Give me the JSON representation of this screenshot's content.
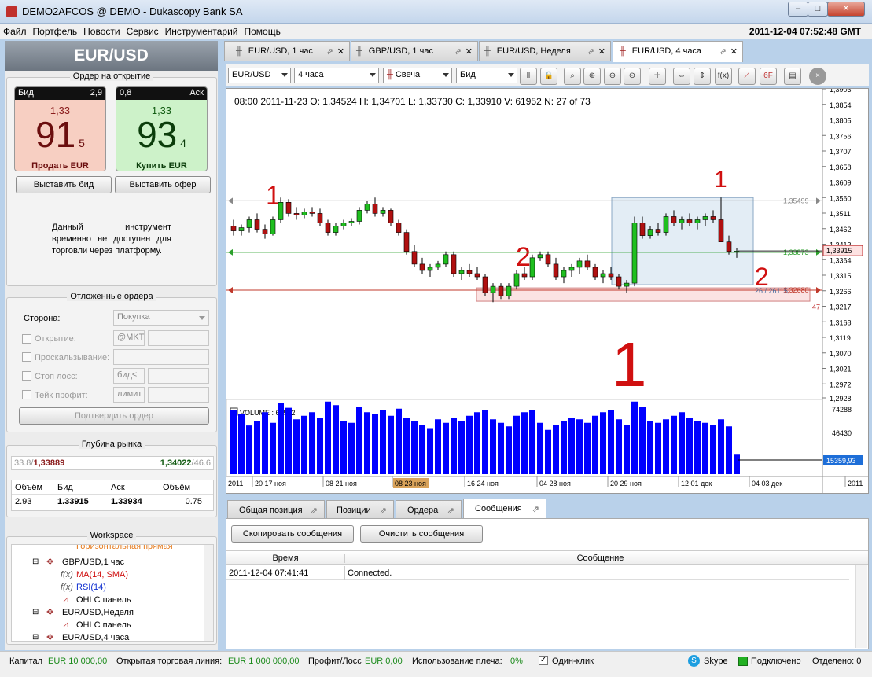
{
  "window": {
    "title": "DEMO2AFCOS @ DEMO - Dukascopy Bank SA",
    "controls": [
      "–",
      "□",
      "✕"
    ]
  },
  "menu": [
    "Файл",
    "Портфель",
    "Новости",
    "Сервис",
    "Инструментарий",
    "Помощь"
  ],
  "clock": "2011-12-04 07:52:48 GMT",
  "instrument": "EUR/USD",
  "order_panel": {
    "title": "Ордер на открытие",
    "bid": {
      "head": "Бид",
      "size": "2,9",
      "prefix": "1,33",
      "pips": "91",
      "fraction": "5",
      "action": "Продать EUR"
    },
    "ask": {
      "head": "Аск",
      "size": "0,8",
      "prefix": "1,33",
      "pips": "93",
      "fraction": "4",
      "action": "Купить EUR"
    },
    "place_bid": "Выставить бид",
    "place_offer": "Выставить офер",
    "notice": "Данный инструмент временно не доступен для торговли через платформу."
  },
  "pending": {
    "title": "Отложенные ордера",
    "side_label": "Сторона:",
    "side_value": "Покупка",
    "open_label": "Открытие:",
    "open_value": "@MKT",
    "slippage_label": "Проскальзывание:",
    "stoploss_label": "Стоп лосс:",
    "stoploss_value": "бид≤",
    "takeprofit_label": "Тейк профит:",
    "takeprofit_value": "лимит",
    "confirm": "Подтвердить ордер"
  },
  "depth": {
    "title": "Глубина рынка",
    "bid_side": "33.8/",
    "bid_price": "1,33889",
    "ask_price": "1,34022",
    "ask_side": "/46.6",
    "headers": [
      "Объём",
      "Бид",
      "Аск",
      "Объём"
    ],
    "row": [
      "2.93",
      "1.33915",
      "1.33934",
      "0.75"
    ]
  },
  "workspace": {
    "title": "Workspace",
    "items": [
      {
        "text": "Горизонтальная прямая"
      },
      {
        "text": "GBP/USD,1 час"
      },
      {
        "text": "MA(14, SMA)",
        "prefix": "f(x)"
      },
      {
        "text": "RSI(14)",
        "prefix": "f(x)"
      },
      {
        "text": "OHLC панель"
      },
      {
        "text": "EUR/USD,Неделя"
      },
      {
        "text": "OHLC панель"
      },
      {
        "text": "EUR/USD,4 часа"
      }
    ]
  },
  "chart_tabs": [
    "EUR/USD, 1 час",
    "GBP/USD, 1 час",
    "EUR/USD, Неделя",
    "EUR/USD, 4 часа"
  ],
  "toolbar": {
    "instrument": "EUR/USD",
    "period": "4 часа",
    "type": "Свеча",
    "side": "Бид"
  },
  "ohlc_line": "08:00 2011-11-23  O: 1,34524  H: 1,34701  L: 1,33730  C: 1,33910  V: 61952  N: 27 of 73",
  "volume_label": "VOLUME : 61952",
  "chart_data": {
    "type": "candlestick",
    "price_axis": [
      "1,3903",
      "1,3854",
      "1,3805",
      "1,3756",
      "1,3707",
      "1,3658",
      "1,3609",
      "1,3560",
      "1,3511",
      "1,3462",
      "1,3413",
      "1,3364",
      "1,3315",
      "1,3266",
      "1,3217",
      "1,3168",
      "1,3119",
      "1,3070",
      "1,3021",
      "1,2972",
      "1,2928"
    ],
    "ylim": [
      1.2928,
      1.3903
    ],
    "volume_axis": [
      "74288",
      "46430"
    ],
    "current_volume": "15359,93",
    "current_price": "1,33915",
    "time_axis": [
      "2011",
      "20 17 ноя",
      "08 21 ноя",
      "08 23 ноя",
      "16 24 ноя",
      "04 28 ноя",
      "20 29 ноя",
      "12 01 дек",
      "04 03 дек",
      "2011"
    ],
    "levels": [
      {
        "price": 1.35499,
        "label": "1,35499",
        "color": "#888888"
      },
      {
        "price": 1.33873,
        "label": "1,33873",
        "color": "#2ca02c"
      },
      {
        "price": 1.3268,
        "label": "1,32680",
        "color": "#c0392b"
      }
    ],
    "ratio_label": "26 / 26115",
    "side_label": "47",
    "candles": [
      [
        1.347,
        1.349,
        1.344,
        1.3455
      ],
      [
        1.3455,
        1.3475,
        1.344,
        1.3465
      ],
      [
        1.3465,
        1.35,
        1.345,
        1.349
      ],
      [
        1.349,
        1.351,
        1.345,
        1.346
      ],
      [
        1.346,
        1.3475,
        1.343,
        1.3445
      ],
      [
        1.3445,
        1.35,
        1.344,
        1.349
      ],
      [
        1.349,
        1.356,
        1.348,
        1.3545
      ],
      [
        1.3545,
        1.3555,
        1.35,
        1.351
      ],
      [
        1.351,
        1.353,
        1.349,
        1.3505
      ],
      [
        1.3505,
        1.3525,
        1.3495,
        1.3515
      ],
      [
        1.3515,
        1.353,
        1.35,
        1.351
      ],
      [
        1.351,
        1.3525,
        1.347,
        1.348
      ],
      [
        1.348,
        1.349,
        1.344,
        1.345
      ],
      [
        1.345,
        1.348,
        1.344,
        1.347
      ],
      [
        1.347,
        1.349,
        1.346,
        1.348
      ],
      [
        1.348,
        1.3495,
        1.347,
        1.3485
      ],
      [
        1.3485,
        1.353,
        1.3475,
        1.352
      ],
      [
        1.352,
        1.355,
        1.351,
        1.354
      ],
      [
        1.354,
        1.356,
        1.35,
        1.351
      ],
      [
        1.351,
        1.353,
        1.35,
        1.352
      ],
      [
        1.352,
        1.3525,
        1.347,
        1.348
      ],
      [
        1.348,
        1.349,
        1.344,
        1.345
      ],
      [
        1.345,
        1.346,
        1.338,
        1.339
      ],
      [
        1.339,
        1.341,
        1.334,
        1.335
      ],
      [
        1.335,
        1.337,
        1.332,
        1.333
      ],
      [
        1.333,
        1.335,
        1.331,
        1.334
      ],
      [
        1.334,
        1.336,
        1.333,
        1.335
      ],
      [
        1.335,
        1.339,
        1.334,
        1.338
      ],
      [
        1.338,
        1.339,
        1.331,
        1.332
      ],
      [
        1.332,
        1.334,
        1.33,
        1.333
      ],
      [
        1.333,
        1.335,
        1.331,
        1.332
      ],
      [
        1.332,
        1.334,
        1.33,
        1.331
      ],
      [
        1.331,
        1.332,
        1.325,
        1.326
      ],
      [
        1.326,
        1.329,
        1.323,
        1.328
      ],
      [
        1.328,
        1.329,
        1.324,
        1.325
      ],
      [
        1.325,
        1.329,
        1.324,
        1.328
      ],
      [
        1.328,
        1.333,
        1.327,
        1.332
      ],
      [
        1.332,
        1.334,
        1.33,
        1.331
      ],
      [
        1.331,
        1.338,
        1.33,
        1.337
      ],
      [
        1.337,
        1.339,
        1.336,
        1.338
      ],
      [
        1.338,
        1.339,
        1.334,
        1.335
      ],
      [
        1.335,
        1.337,
        1.33,
        1.331
      ],
      [
        1.331,
        1.334,
        1.329,
        1.333
      ],
      [
        1.333,
        1.335,
        1.331,
        1.334
      ],
      [
        1.334,
        1.337,
        1.332,
        1.336
      ],
      [
        1.336,
        1.338,
        1.333,
        1.334
      ],
      [
        1.334,
        1.335,
        1.33,
        1.331
      ],
      [
        1.331,
        1.333,
        1.329,
        1.332
      ],
      [
        1.332,
        1.334,
        1.33,
        1.331
      ],
      [
        1.331,
        1.332,
        1.327,
        1.328
      ],
      [
        1.328,
        1.33,
        1.326,
        1.329
      ],
      [
        1.329,
        1.35,
        1.328,
        1.348
      ],
      [
        1.348,
        1.35,
        1.343,
        1.344
      ],
      [
        1.344,
        1.347,
        1.343,
        1.346
      ],
      [
        1.346,
        1.348,
        1.344,
        1.345
      ],
      [
        1.345,
        1.351,
        1.344,
        1.35
      ],
      [
        1.35,
        1.352,
        1.347,
        1.348
      ],
      [
        1.348,
        1.35,
        1.346,
        1.349
      ],
      [
        1.349,
        1.351,
        1.347,
        1.348
      ],
      [
        1.348,
        1.35,
        1.346,
        1.349
      ],
      [
        1.349,
        1.351,
        1.347,
        1.35
      ],
      [
        1.35,
        1.352,
        1.348,
        1.349
      ],
      [
        1.349,
        1.356,
        1.344,
        1.342
      ],
      [
        1.342,
        1.344,
        1.338,
        1.339
      ],
      [
        1.339,
        1.34,
        1.337,
        1.3391
      ]
    ],
    "volumes": [
      72,
      68,
      55,
      60,
      70,
      58,
      80,
      75,
      62,
      66,
      70,
      64,
      82,
      78,
      60,
      58,
      76,
      70,
      68,
      72,
      66,
      74,
      64,
      60,
      56,
      52,
      62,
      58,
      64,
      60,
      66,
      70,
      72,
      62,
      58,
      54,
      66,
      70,
      72,
      58,
      50,
      56,
      60,
      64,
      62,
      58,
      66,
      70,
      72,
      62,
      56,
      82,
      76,
      60,
      58,
      62,
      66,
      70,
      64,
      60,
      58,
      56,
      62,
      54,
      22
    ],
    "volume_max": 80000
  },
  "annotations": [
    "1",
    "2",
    "1",
    "2",
    "1"
  ],
  "bottom_tabs": [
    "Общая позиция",
    "Позиции",
    "Ордера",
    "Сообщения"
  ],
  "messages": {
    "copy": "Скопировать сообщения",
    "clear": "Очистить сообщения",
    "headers": [
      "Время",
      "Сообщение"
    ],
    "rows": [
      [
        "2011-12-04 07:41:41",
        "Connected."
      ]
    ]
  },
  "status": {
    "capital_label": "Капитал",
    "capital": "EUR 10 000,00",
    "line_label": "Открытая торговая линия:",
    "line": "EUR 1 000 000,00",
    "pl_label": "Профит/Лосс",
    "pl": "EUR 0,00",
    "leverage_label": "Использование плеча:",
    "leverage": "0%",
    "oneclick": "Один-клик",
    "skype": "Skype",
    "connected": "Подключено",
    "detached": "Отделено: 0"
  }
}
